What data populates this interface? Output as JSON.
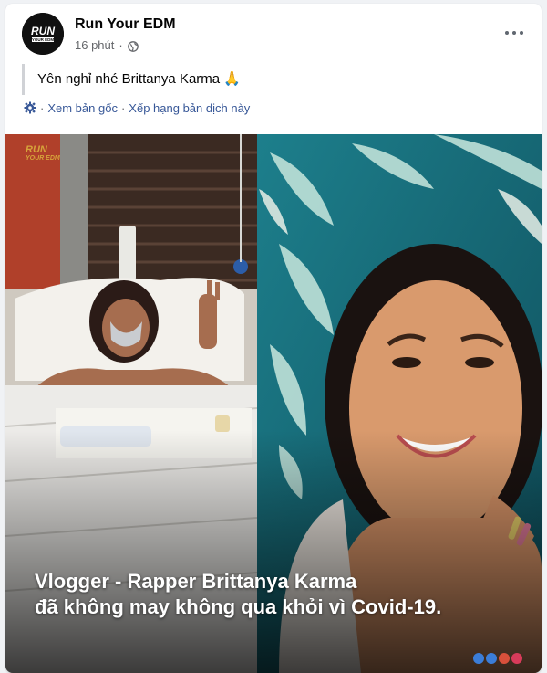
{
  "post": {
    "page_name": "Run Your EDM",
    "time": "16 phút",
    "separator": "·",
    "text": "Yên nghỉ nhé Brittanya Karma 🙏",
    "translation": {
      "see_original": "Xem bản gốc",
      "separator": "·",
      "rate_translation": "Xếp hạng bản dịch này"
    }
  },
  "avatar": {
    "logo_text": "RUN",
    "logo_sub": "YOUR EDM"
  },
  "media": {
    "watermark": "RUN",
    "watermark_sub": "YOUR EDM",
    "caption_line1": "Vlogger - Rapper Brittanya Karma",
    "caption_line2": "đã không may không qua khỏi vì Covid-19."
  },
  "colors": {
    "accent_link": "#385898",
    "secondary_text": "#65676b",
    "watermark": "#d6a23a"
  },
  "icons": [
    "globe-icon",
    "more-options-icon",
    "translate-gear-icon"
  ]
}
